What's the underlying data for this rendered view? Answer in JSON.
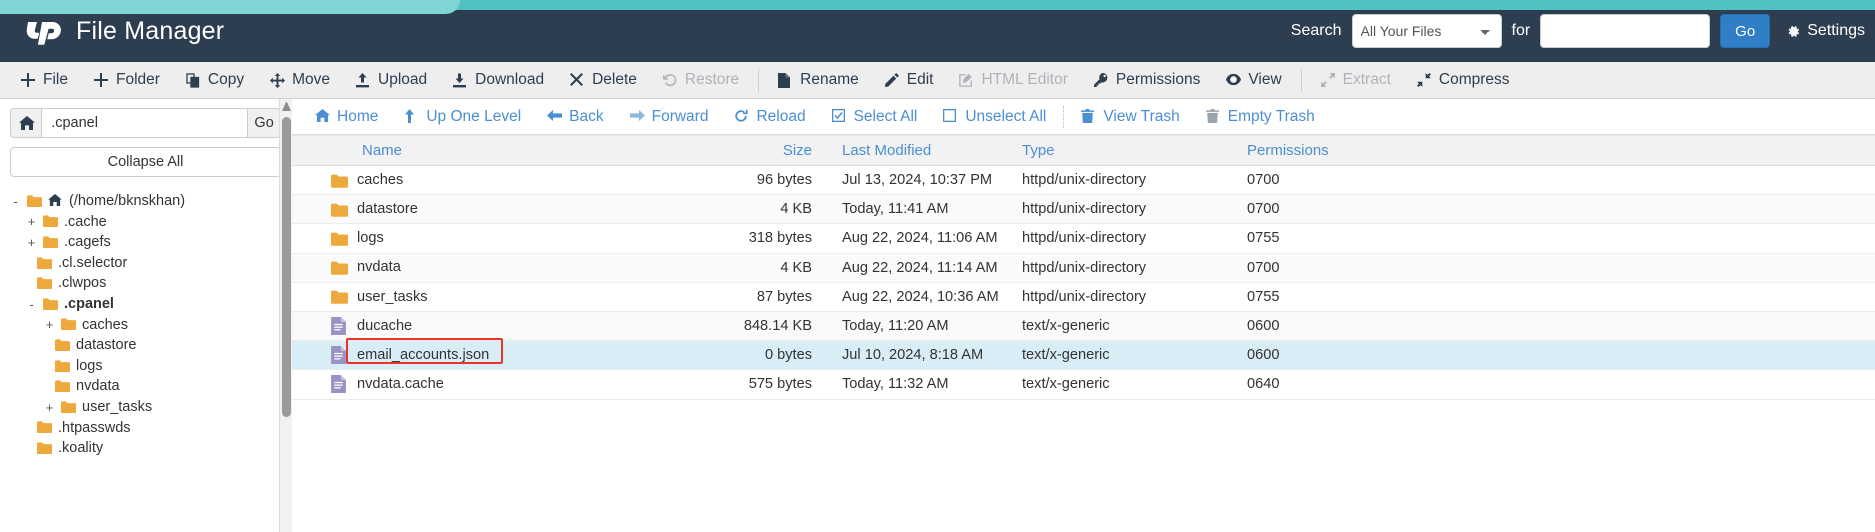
{
  "header": {
    "brand_title": "File Manager",
    "logo_icon": "cpanel-logo-icon",
    "search_label": "Search",
    "search_scope_selected": "All Your Files",
    "search_scope_options": [
      "All Your Files"
    ],
    "search_for_label": "for",
    "search_value": "",
    "search_placeholder": "",
    "go_label": "Go",
    "settings_label": "Settings",
    "settings_icon": "gear-icon",
    "accent_color": "#4fc3c3",
    "bg_color": "#2d3e50"
  },
  "toolbar": {
    "items": [
      {
        "label": "File",
        "icon": "plus-icon",
        "disabled": false
      },
      {
        "label": "Folder",
        "icon": "plus-icon",
        "disabled": false
      },
      {
        "label": "Copy",
        "icon": "copy-icon",
        "disabled": false
      },
      {
        "label": "Move",
        "icon": "move-arrows-icon",
        "disabled": false
      },
      {
        "label": "Upload",
        "icon": "upload-icon",
        "disabled": false
      },
      {
        "label": "Download",
        "icon": "download-icon",
        "disabled": false
      },
      {
        "label": "Delete",
        "icon": "x-icon",
        "disabled": false
      },
      {
        "label": "Restore",
        "icon": "undo-icon",
        "disabled": true
      },
      {
        "label": "Rename",
        "icon": "file-icon",
        "disabled": false
      },
      {
        "label": "Edit",
        "icon": "pencil-icon",
        "disabled": false
      },
      {
        "label": "HTML Editor",
        "icon": "html-edit-icon",
        "disabled": true
      },
      {
        "label": "Permissions",
        "icon": "key-icon",
        "disabled": false
      },
      {
        "label": "View",
        "icon": "eye-icon",
        "disabled": false
      },
      {
        "label": "Extract",
        "icon": "expand-icon",
        "disabled": true
      },
      {
        "label": "Compress",
        "icon": "compress-icon",
        "disabled": false
      }
    ]
  },
  "sidebar": {
    "home_icon": "home-icon",
    "path_value": ".cpanel",
    "path_go_label": "Go",
    "collapse_label": "Collapse All",
    "tree": [
      {
        "label": "(/home/bknskhan)",
        "depth": 0,
        "toggle": "-",
        "icon": "home-folder-icon",
        "bold": false
      },
      {
        "label": ".cache",
        "depth": 1,
        "toggle": "+",
        "icon": "folder-icon",
        "bold": false
      },
      {
        "label": ".cagefs",
        "depth": 1,
        "toggle": "+",
        "icon": "folder-icon",
        "bold": false
      },
      {
        "label": ".cl.selector",
        "depth": 1,
        "toggle": "",
        "icon": "folder-icon",
        "bold": false
      },
      {
        "label": ".clwpos",
        "depth": 1,
        "toggle": "",
        "icon": "folder-icon",
        "bold": false
      },
      {
        "label": ".cpanel",
        "depth": 1,
        "toggle": "-",
        "icon": "folder-icon",
        "bold": true
      },
      {
        "label": "caches",
        "depth": 2,
        "toggle": "+",
        "icon": "folder-icon",
        "bold": false
      },
      {
        "label": "datastore",
        "depth": 2,
        "toggle": "",
        "icon": "folder-icon",
        "bold": false
      },
      {
        "label": "logs",
        "depth": 2,
        "toggle": "",
        "icon": "folder-icon",
        "bold": false
      },
      {
        "label": "nvdata",
        "depth": 2,
        "toggle": "",
        "icon": "folder-icon",
        "bold": false
      },
      {
        "label": "user_tasks",
        "depth": 2,
        "toggle": "+",
        "icon": "folder-icon",
        "bold": false
      },
      {
        "label": ".htpasswds",
        "depth": 1,
        "toggle": "",
        "icon": "folder-icon",
        "bold": false
      },
      {
        "label": ".koality",
        "depth": 1,
        "toggle": "",
        "icon": "folder-icon",
        "bold": false
      }
    ]
  },
  "navbar": {
    "items": [
      {
        "label": "Home",
        "icon": "home-icon"
      },
      {
        "label": "Up One Level",
        "icon": "arrow-up-icon"
      },
      {
        "label": "Back",
        "icon": "arrow-left-icon"
      },
      {
        "label": "Forward",
        "icon": "arrow-right-icon"
      },
      {
        "label": "Reload",
        "icon": "refresh-icon"
      },
      {
        "label": "Select All",
        "icon": "checkbox-checked-icon"
      },
      {
        "label": "Unselect All",
        "icon": "checkbox-empty-icon"
      },
      {
        "label": "View Trash",
        "icon": "trash-icon"
      },
      {
        "label": "Empty Trash",
        "icon": "trash-icon"
      }
    ],
    "separator_after_index": 6
  },
  "filetable": {
    "columns": [
      "Name",
      "Size",
      "Last Modified",
      "Type",
      "Permissions"
    ],
    "annotation": {
      "target_row_index": 7,
      "color": "#e8352a"
    },
    "rows": [
      {
        "name": "caches",
        "icon": "folder-icon",
        "size": "96 bytes",
        "modified": "Jul 13, 2024, 10:37 PM",
        "type": "httpd/unix-directory",
        "permissions": "0700",
        "selected": false
      },
      {
        "name": "datastore",
        "icon": "folder-icon",
        "size": "4 KB",
        "modified": "Today, 11:41 AM",
        "type": "httpd/unix-directory",
        "permissions": "0700",
        "selected": false
      },
      {
        "name": "logs",
        "icon": "folder-icon",
        "size": "318 bytes",
        "modified": "Aug 22, 2024, 11:06 AM",
        "type": "httpd/unix-directory",
        "permissions": "0755",
        "selected": false
      },
      {
        "name": "nvdata",
        "icon": "folder-icon",
        "size": "4 KB",
        "modified": "Aug 22, 2024, 11:14 AM",
        "type": "httpd/unix-directory",
        "permissions": "0700",
        "selected": false
      },
      {
        "name": "user_tasks",
        "icon": "folder-icon",
        "size": "87 bytes",
        "modified": "Aug 22, 2024, 10:36 AM",
        "type": "httpd/unix-directory",
        "permissions": "0755",
        "selected": false
      },
      {
        "name": "ducache",
        "icon": "file-icon",
        "size": "848.14 KB",
        "modified": "Today, 11:20 AM",
        "type": "text/x-generic",
        "permissions": "0600",
        "selected": false
      },
      {
        "name": "email_accounts.json",
        "icon": "file-icon",
        "size": "0 bytes",
        "modified": "Jul 10, 2024, 8:18 AM",
        "type": "text/x-generic",
        "permissions": "0600",
        "selected": true
      },
      {
        "name": "nvdata.cache",
        "icon": "file-icon",
        "size": "575 bytes",
        "modified": "Today, 11:32 AM",
        "type": "text/x-generic",
        "permissions": "0640",
        "selected": false
      }
    ]
  }
}
